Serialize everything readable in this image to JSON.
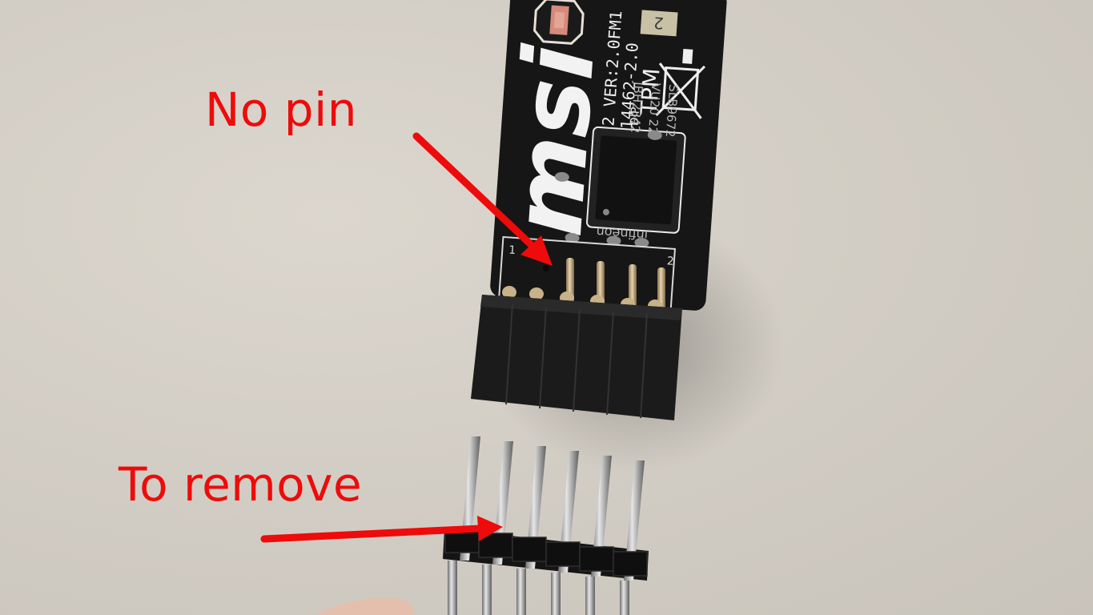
{
  "annotations": {
    "no_pin_label": "No pin",
    "to_remove_label": "To remove",
    "arrow_color": "#ee0b0b"
  },
  "board": {
    "brand": "msi",
    "model_text": "MS-4462 VER:2.0FM1",
    "part_text": "14462-2.0",
    "tpm_text": "TPM",
    "dip_text": "DIP",
    "corner_number": "2",
    "chip": {
      "line1": "infineon",
      "line2": "SLB9672",
      "line3": "VU20 22",
      "line4": "JBH2342"
    },
    "header_pin1_label": "1",
    "header_pin2_label": "2"
  },
  "loose_pin_header": {
    "pin_count": 6
  }
}
